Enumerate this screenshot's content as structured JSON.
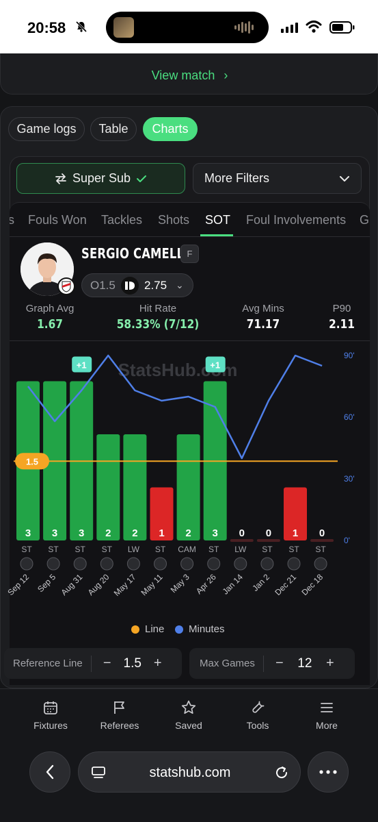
{
  "status_bar": {
    "time": "20:58"
  },
  "top_card": {
    "view_match_label": "View match"
  },
  "view_tabs": [
    "Game logs",
    "Table",
    "Charts"
  ],
  "active_view": "Charts",
  "filters": {
    "super_sub_label": "Super Sub",
    "more_filters_label": "More Filters"
  },
  "stat_tabs": [
    "s",
    "Fouls Won",
    "Tackles",
    "Shots",
    "SOT",
    "Foul Involvements",
    "G"
  ],
  "active_stat_tab": "SOT",
  "player": {
    "name": "SERGIO CAMELLO",
    "position": "F",
    "line_label": "O1.5",
    "odds": "2.75"
  },
  "stats": [
    {
      "label": "Graph Avg",
      "value": "1.67",
      "color": "#86efac"
    },
    {
      "label": "Hit Rate",
      "value": "58.33% (7/12)",
      "color": "#86efac"
    },
    {
      "label": "Avg Mins",
      "value": "71.17",
      "color": "#ffffff"
    },
    {
      "label": "P90",
      "value": "2.11",
      "color": "#ffffff"
    }
  ],
  "watermark": "StatsHub.com",
  "chart_data": {
    "type": "bar",
    "categories": [
      "Sep 12",
      "Sep 5",
      "Aug 31",
      "Aug 20",
      "May 17",
      "May 11",
      "May 3",
      "Apr 26",
      "Jan 14",
      "Jan 2",
      "Dec 21",
      "Dec 18"
    ],
    "positions": [
      "ST",
      "ST",
      "ST",
      "ST",
      "LW",
      "ST",
      "CAM",
      "ST",
      "LW",
      "ST",
      "ST",
      "ST"
    ],
    "series": [
      {
        "name": "SOT",
        "values": [
          3,
          3,
          3,
          2,
          2,
          1,
          2,
          3,
          0,
          0,
          1,
          0
        ]
      },
      {
        "name": "Minutes",
        "values": [
          75,
          58,
          73,
          90,
          73,
          68,
          70,
          65,
          40,
          68,
          90,
          85
        ],
        "color": "#4f7fe8"
      }
    ],
    "extra_badges": [
      {
        "index": 2,
        "label": "+1"
      },
      {
        "index": 7,
        "label": "+1"
      }
    ],
    "reference_line": 1.5,
    "line_color": "#f5a524",
    "hit_color": "#22a447",
    "miss_color": "#dc2626",
    "left_axis": [
      0,
      3.5
    ],
    "right_axis": {
      "ticks": [
        "0'",
        "30'",
        "60'",
        "90'"
      ],
      "range": [
        0,
        90
      ]
    },
    "legend": [
      "Line",
      "Minutes"
    ],
    "legend_colors": [
      "#f5a524",
      "#4f7fe8"
    ]
  },
  "controls": {
    "reference_line": {
      "label": "Reference Line",
      "value": "1.5"
    },
    "max_games": {
      "label": "Max Games",
      "value": "12"
    }
  },
  "bottom_nav": [
    "Fixtures",
    "Referees",
    "Saved",
    "Tools",
    "More"
  ],
  "browser": {
    "url": "statshub.com"
  }
}
